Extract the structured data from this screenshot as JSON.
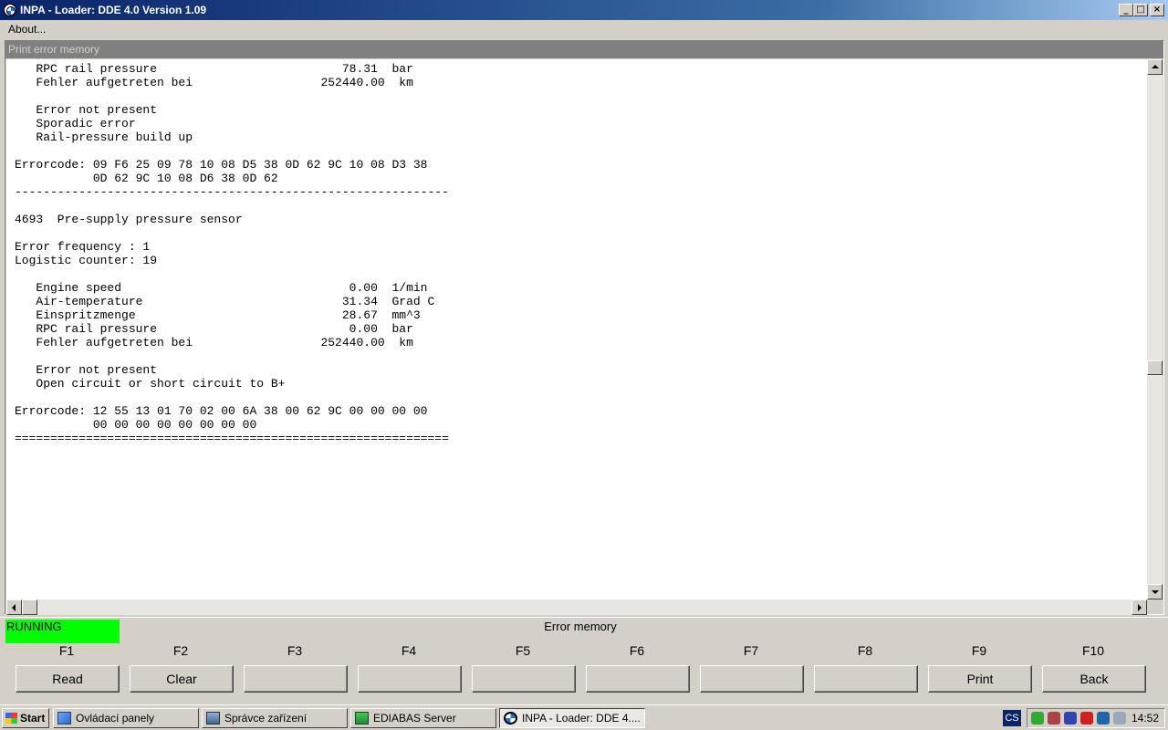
{
  "window": {
    "title": "INPA - Loader: DDE 4.0 Version 1.09"
  },
  "menu": {
    "about": "About..."
  },
  "panel": {
    "header": "Print error memory",
    "text": "   RPC rail pressure                          78.31  bar\n   Fehler aufgetreten bei                  252440.00  km\n\n   Error not present\n   Sporadic error\n   Rail-pressure build up\n\nErrorcode: 09 F6 25 09 78 10 08 D5 38 0D 62 9C 10 08 D3 38\n           0D 62 9C 10 08 D6 38 0D 62\n-------------------------------------------------------------\n\n4693  Pre-supply pressure sensor\n\nError frequency : 1\nLogistic counter: 19\n\n   Engine speed                                0.00  1/min\n   Air-temperature                            31.34  Grad C\n   Einspritzmenge                             28.67  mm^3\n   RPC rail pressure                           0.00  bar\n   Fehler aufgetreten bei                  252440.00  km\n\n   Error not present\n   Open circuit or short circuit to B+\n\nErrorcode: 12 55 13 01 70 02 00 6A 38 00 62 9C 00 00 00 00\n           00 00 00 00 00 00 00 00\n============================================================="
  },
  "status": {
    "state": "RUNNING",
    "title": "Error memory",
    "state_color": "#00ff00"
  },
  "fkeys": [
    {
      "key": "F1",
      "label": "Read"
    },
    {
      "key": "F2",
      "label": "Clear"
    },
    {
      "key": "F3",
      "label": ""
    },
    {
      "key": "F4",
      "label": ""
    },
    {
      "key": "F5",
      "label": ""
    },
    {
      "key": "F6",
      "label": ""
    },
    {
      "key": "F7",
      "label": ""
    },
    {
      "key": "F8",
      "label": ""
    },
    {
      "key": "F9",
      "label": "Print"
    },
    {
      "key": "F10",
      "label": "Back"
    }
  ],
  "taskbar": {
    "start": "Start",
    "tasks": [
      {
        "label": "Ovládací panely",
        "icon": "control-panel-icon"
      },
      {
        "label": "Správce zařízení",
        "icon": "device-manager-icon"
      },
      {
        "label": "EDIABAS Server",
        "icon": "ediabas-icon"
      },
      {
        "label": "INPA - Loader:  DDE 4....",
        "icon": "bmw-icon"
      }
    ],
    "language": "CS",
    "clock": "14:52"
  }
}
